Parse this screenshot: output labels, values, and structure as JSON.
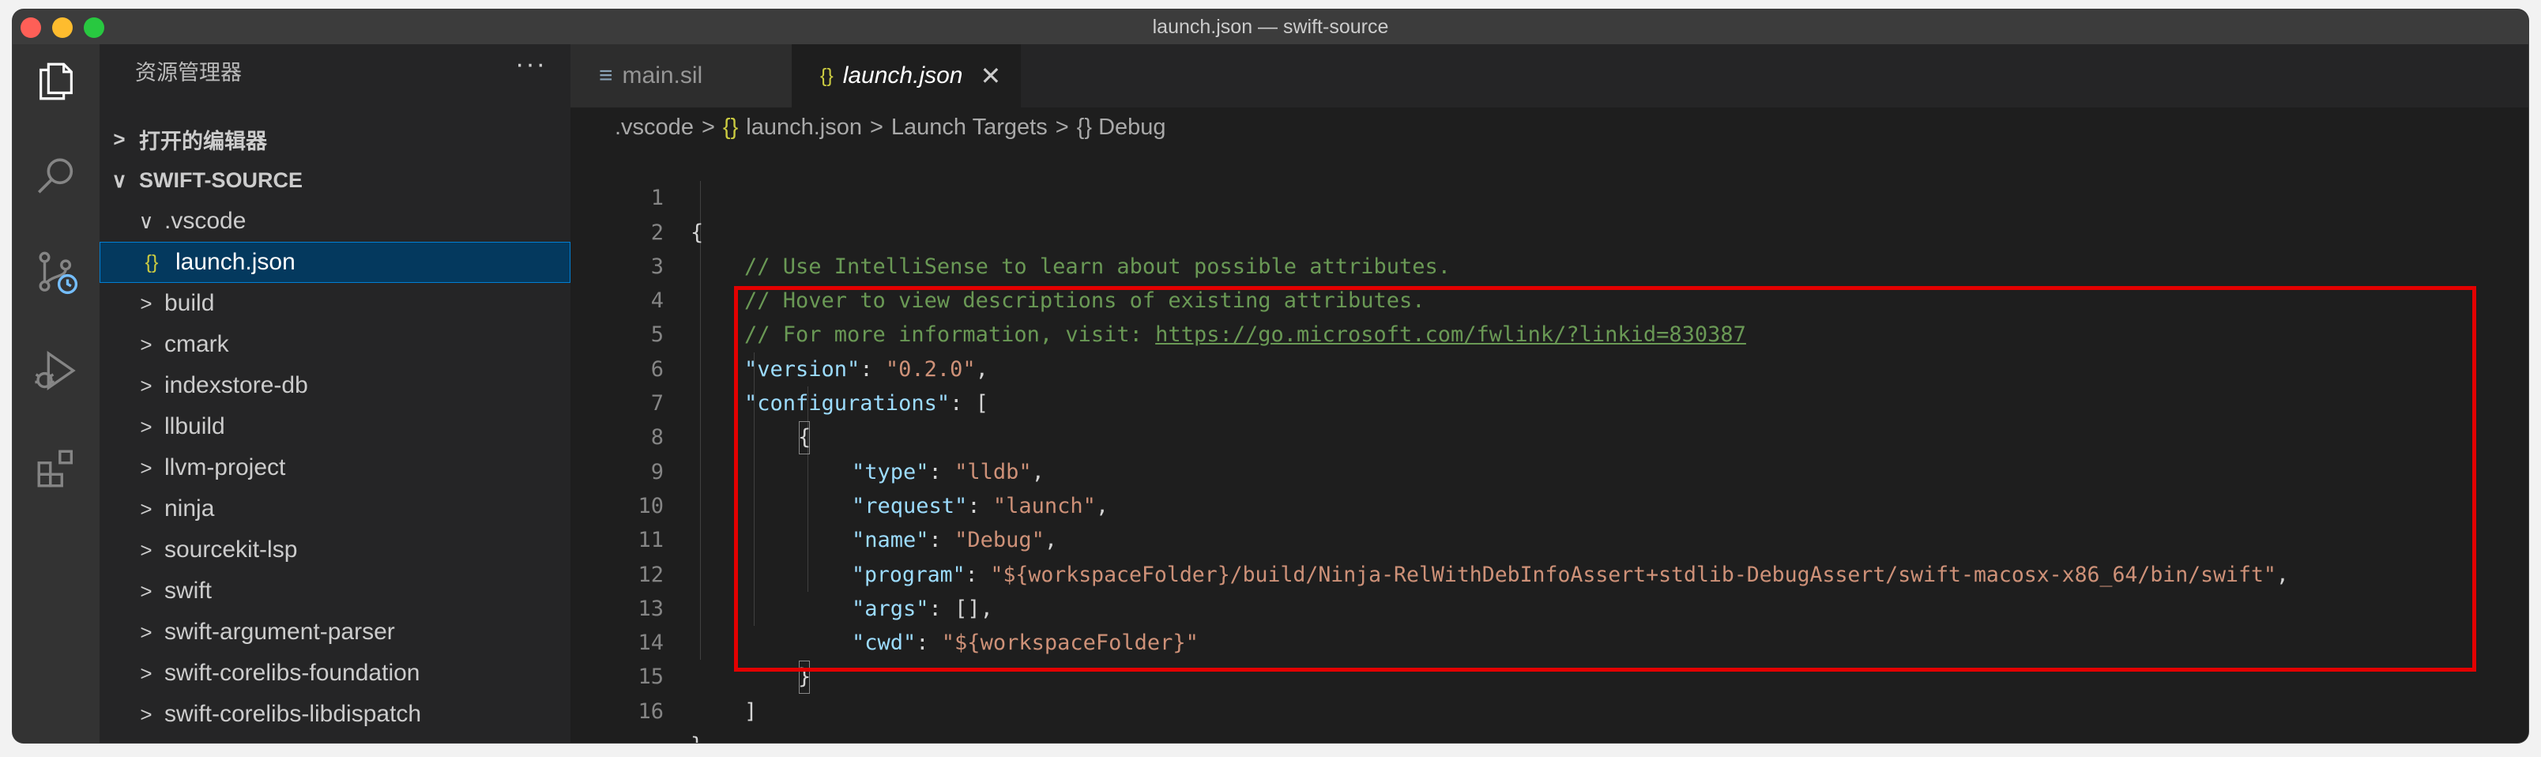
{
  "window": {
    "title": "launch.json — swift-source"
  },
  "sidebar": {
    "title": "资源管理器",
    "more": "···",
    "open_editors": "打开的编辑器",
    "root": "SWIFT-SOURCE",
    "items": [
      {
        "label": ".vscode",
        "chevron": "∨"
      },
      {
        "label": "launch.json",
        "icon": "{}"
      },
      {
        "label": "build",
        "chevron": ">"
      },
      {
        "label": "cmark",
        "chevron": ">"
      },
      {
        "label": "indexstore-db",
        "chevron": ">"
      },
      {
        "label": "llbuild",
        "chevron": ">"
      },
      {
        "label": "llvm-project",
        "chevron": ">"
      },
      {
        "label": "ninja",
        "chevron": ">"
      },
      {
        "label": "sourcekit-lsp",
        "chevron": ">"
      },
      {
        "label": "swift",
        "chevron": ">"
      },
      {
        "label": "swift-argument-parser",
        "chevron": ">"
      },
      {
        "label": "swift-corelibs-foundation",
        "chevron": ">"
      },
      {
        "label": "swift-corelibs-libdispatch",
        "chevron": ">"
      }
    ]
  },
  "tabs": [
    {
      "label": "main.sil",
      "icon": "≡"
    },
    {
      "label": "launch.json",
      "icon": "{}",
      "close": "✕"
    }
  ],
  "breadcrumb": [
    ".vscode",
    ">",
    "{} launch.json",
    ">",
    "Launch Targets",
    ">",
    "{} Debug"
  ],
  "code": {
    "line_numbers": [
      "1",
      "2",
      "3",
      "4",
      "5",
      "6",
      "7",
      "8",
      "9",
      "10",
      "11",
      "12",
      "13",
      "14",
      "15",
      "16"
    ],
    "l1": "{",
    "l2": "// Use IntelliSense to learn about possible attributes.",
    "l3": "// Hover to view descriptions of existing attributes.",
    "l4_comment": "// For more information, visit: ",
    "l4_link": "https://go.microsoft.com/fwlink/?linkid=830387",
    "l5_key": "\"version\"",
    "l5_val": "\"0.2.0\"",
    "l6_key": "\"configurations\"",
    "l6_bracket": "[",
    "l7": "{",
    "l8_key": "\"type\"",
    "l8_val": "\"lldb\"",
    "l9_key": "\"request\"",
    "l9_val": "\"launch\"",
    "l10_key": "\"name\"",
    "l10_val": "\"Debug\"",
    "l11_key": "\"program\"",
    "l11_val": "\"${workspaceFolder}/build/Ninja-RelWithDebInfoAssert+stdlib-DebugAssert/swift-macosx-x86_64/bin/swift\"",
    "l12_key": "\"args\"",
    "l12_val": "[]",
    "l13_key": "\"cwd\"",
    "l13_val": "\"${workspaceFolder}\"",
    "l14": "}",
    "l15": "]",
    "l16": "}"
  },
  "colors": {
    "comment": "#6a9955",
    "key": "#9cdcfe",
    "string": "#ce9178",
    "punct": "#d4d4d4",
    "highlight_border": "#e30000"
  }
}
